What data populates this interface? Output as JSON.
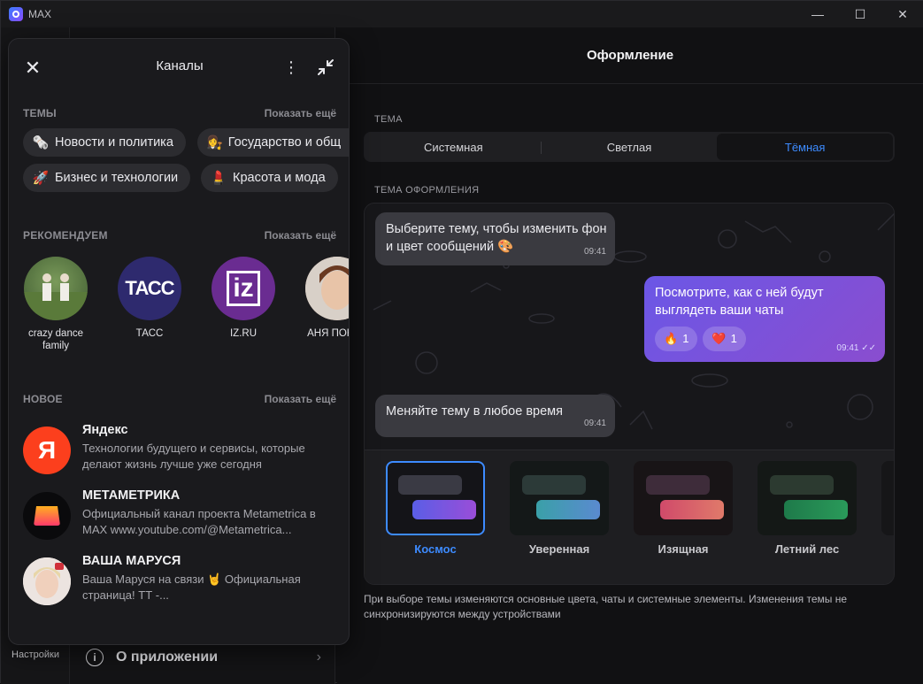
{
  "window": {
    "title": "MAX",
    "minimize": "—",
    "maximize": "☐",
    "close": "✕"
  },
  "background": {
    "settings_label": "Настройки",
    "about_label": "О приложении",
    "about_icon": "i",
    "about_chevron": "›"
  },
  "appearance": {
    "header": "Оформление",
    "theme_label": "ТЕМА",
    "theme_options": [
      "Системная",
      "Светлая",
      "Тёмная"
    ],
    "selected_theme": "Тёмная",
    "design_label": "ТЕМА ОФОРМЛЕНИЯ",
    "messages": [
      {
        "text": "Выберите тему, чтобы изменить фон и цвет сообщений 🎨",
        "time": "09:41",
        "dir": "in"
      },
      {
        "text": "Посмотрите, как с ней будут выглядеть ваши чаты",
        "time": "09:41",
        "dir": "out",
        "reactions": [
          {
            "emoji": "🔥",
            "count": "1"
          },
          {
            "emoji": "❤️",
            "count": "1"
          }
        ]
      },
      {
        "text": "Меняйте тему в любое время",
        "time": "09:41",
        "dir": "in"
      }
    ],
    "themes": [
      {
        "name": "Космос",
        "selected": true
      },
      {
        "name": "Уверенная",
        "selected": false
      },
      {
        "name": "Изящная",
        "selected": false
      },
      {
        "name": "Летний лес",
        "selected": false
      }
    ],
    "note": "При выборе темы изменяются основные цвета, чаты и системные элементы. Изменения темы не синхронизируются между устройствами"
  },
  "channels": {
    "title": "Каналы",
    "menu_icon": "⋮",
    "close_icon": "✕",
    "topics": {
      "title": "ТЕМЫ",
      "more": "Показать ещё",
      "items": [
        {
          "emoji": "🗞️",
          "label": "Новости и политика"
        },
        {
          "emoji": "👩‍⚖️",
          "label": "Государство и общ"
        },
        {
          "emoji": "🚀",
          "label": "Бизнес и технологии"
        },
        {
          "emoji": "💄",
          "label": "Красота и мода"
        }
      ]
    },
    "recommended": {
      "title": "РЕКОМЕНДУЕМ",
      "more": "Показать ещё",
      "items": [
        {
          "name": "crazy dance family",
          "logo": ""
        },
        {
          "name": "ТАСС",
          "logo": "ТАСС"
        },
        {
          "name": "IZ.RU",
          "logo": "iz"
        },
        {
          "name": "АНЯ ПОКРО",
          "logo": ""
        }
      ]
    },
    "new": {
      "title": "НОВОЕ",
      "more": "Показать ещё",
      "items": [
        {
          "title": "Яндекс",
          "desc": "Технологии будущего и сервисы, которые делают жизнь лучше уже сегодня",
          "logo": "Я"
        },
        {
          "title": "МЕТАМЕТРИКА",
          "desc": "Официальный канал проекта Metametrica в MAX www.youtube.com/@Metametrica...",
          "logo": ""
        },
        {
          "title": "ВАША МАРУСЯ",
          "desc": "Ваша Маруся на связи 🤘 Официальная страница! ТТ -...",
          "logo": ""
        }
      ]
    }
  },
  "colors": {
    "accent": "#3d8bff",
    "yandex": "#fc3f1d",
    "tass": "#2e2a6e",
    "iz": "#6a2c91"
  }
}
